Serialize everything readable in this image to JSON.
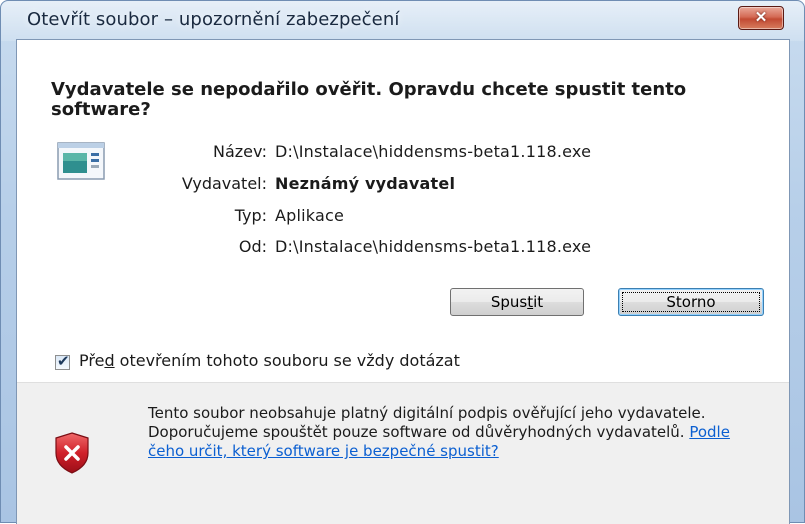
{
  "window": {
    "title": "Otevřít soubor – upozornění zabezpečení",
    "close_label": "✕"
  },
  "headline": "Vydavatele se nepodařilo ověřit. Opravdu chcete spustit tento software?",
  "file_icon": "executable-file-icon",
  "details": [
    {
      "label": "Název:",
      "value": "D:\\Instalace\\hiddensms-beta1.118.exe",
      "bold": false
    },
    {
      "label": "Vydavatel:",
      "value": "Neznámý vydavatel",
      "bold": true
    },
    {
      "label": "Typ:",
      "value": "Aplikace",
      "bold": false
    },
    {
      "label": "Od:",
      "value": "D:\\Instalace\\hiddensms-beta1.118.exe",
      "bold": false
    }
  ],
  "buttons": {
    "run": {
      "pre": "Spus",
      "underline": "t",
      "post": "it"
    },
    "cancel": "Storno"
  },
  "checkbox": {
    "checked": true,
    "label_pre": "Pře",
    "label_underline": "d",
    "label_post": " otevřením tohoto souboru se vždy dotázat"
  },
  "footer": {
    "icon": "security-warning-shield-icon",
    "text": "Tento soubor neobsahuje platný digitální podpis ověřující jeho vydavatele. Doporučujeme spouštět pouze software od důvěryhodných vydavatelů. ",
    "link": "Podle čeho určit, který software je bezpečné spustit?"
  },
  "colors": {
    "link": "#0b5fd1",
    "close_button": "#c24a33",
    "shield_red": "#c8102e"
  }
}
